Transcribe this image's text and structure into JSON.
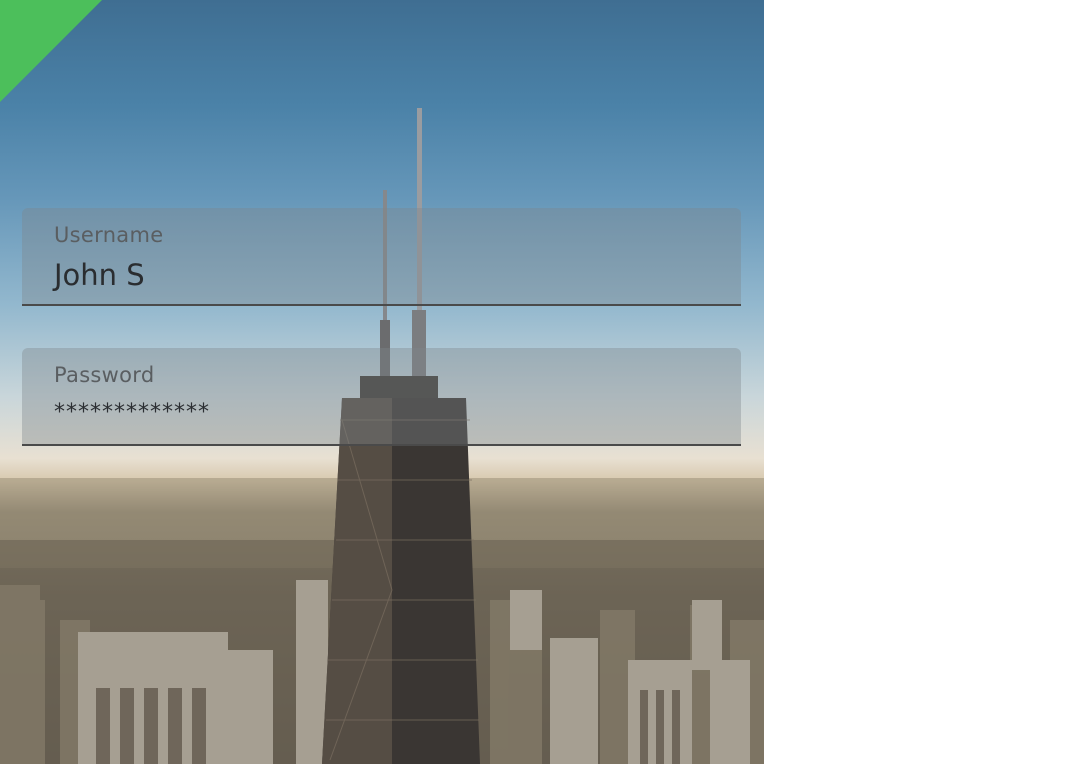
{
  "form": {
    "username": {
      "label": "Username",
      "value": "John S"
    },
    "password": {
      "label": "Password",
      "value": "*************"
    }
  },
  "colors": {
    "accent": "#4cbf5b",
    "field_underline": "#4a4a4a"
  }
}
